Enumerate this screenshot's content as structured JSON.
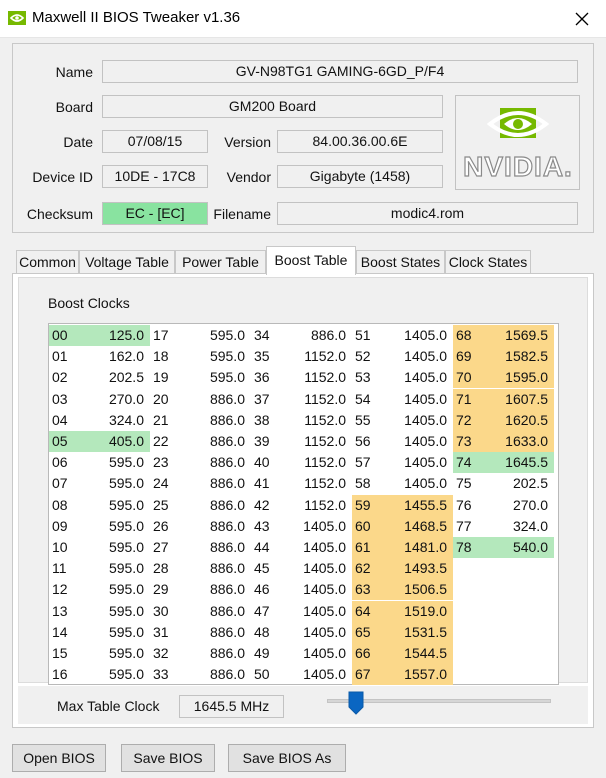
{
  "window": {
    "title": "Maxwell II BIOS Tweaker v1.36"
  },
  "info": {
    "name_label": "Name",
    "name_value": "GV-N98TG1 GAMING-6GD_P/F4",
    "board_label": "Board",
    "board_value": "GM200 Board",
    "date_label": "Date",
    "date_value": "07/08/15",
    "version_label": "Version",
    "version_value": "84.00.36.00.6E",
    "device_label": "Device ID",
    "device_value": "10DE - 17C8",
    "vendor_label": "Vendor",
    "vendor_value": "Gigabyte (1458)",
    "checksum_label": "Checksum",
    "checksum_value": "EC - [EC]",
    "filename_label": "Filename",
    "filename_value": "modic4.rom",
    "logo_text": "NVIDIA.",
    "checksum_color": "#89e3a0"
  },
  "tabs": [
    {
      "label": "Common"
    },
    {
      "label": "Voltage Table"
    },
    {
      "label": "Power Table"
    },
    {
      "label": "Boost Table"
    },
    {
      "label": "Boost States"
    },
    {
      "label": "Clock States"
    }
  ],
  "boost": {
    "group_title": "Boost Clocks",
    "highlight_green": "#b4e8bc",
    "highlight_yellow": "#fbd88a",
    "columns": [
      {
        "entries": [
          {
            "idx": "00",
            "val": "125.0",
            "hl": "green"
          },
          {
            "idx": "01",
            "val": "162.0",
            "hl": ""
          },
          {
            "idx": "02",
            "val": "202.5",
            "hl": ""
          },
          {
            "idx": "03",
            "val": "270.0",
            "hl": ""
          },
          {
            "idx": "04",
            "val": "324.0",
            "hl": ""
          },
          {
            "idx": "05",
            "val": "405.0",
            "hl": "green"
          },
          {
            "idx": "06",
            "val": "595.0",
            "hl": ""
          },
          {
            "idx": "07",
            "val": "595.0",
            "hl": ""
          },
          {
            "idx": "08",
            "val": "595.0",
            "hl": ""
          },
          {
            "idx": "09",
            "val": "595.0",
            "hl": ""
          },
          {
            "idx": "10",
            "val": "595.0",
            "hl": ""
          },
          {
            "idx": "11",
            "val": "595.0",
            "hl": ""
          },
          {
            "idx": "12",
            "val": "595.0",
            "hl": ""
          },
          {
            "idx": "13",
            "val": "595.0",
            "hl": ""
          },
          {
            "idx": "14",
            "val": "595.0",
            "hl": ""
          },
          {
            "idx": "15",
            "val": "595.0",
            "hl": ""
          },
          {
            "idx": "16",
            "val": "595.0",
            "hl": ""
          }
        ]
      },
      {
        "entries": [
          {
            "idx": "17",
            "val": "595.0",
            "hl": ""
          },
          {
            "idx": "18",
            "val": "595.0",
            "hl": ""
          },
          {
            "idx": "19",
            "val": "595.0",
            "hl": ""
          },
          {
            "idx": "20",
            "val": "886.0",
            "hl": ""
          },
          {
            "idx": "21",
            "val": "886.0",
            "hl": ""
          },
          {
            "idx": "22",
            "val": "886.0",
            "hl": ""
          },
          {
            "idx": "23",
            "val": "886.0",
            "hl": ""
          },
          {
            "idx": "24",
            "val": "886.0",
            "hl": ""
          },
          {
            "idx": "25",
            "val": "886.0",
            "hl": ""
          },
          {
            "idx": "26",
            "val": "886.0",
            "hl": ""
          },
          {
            "idx": "27",
            "val": "886.0",
            "hl": ""
          },
          {
            "idx": "28",
            "val": "886.0",
            "hl": ""
          },
          {
            "idx": "29",
            "val": "886.0",
            "hl": ""
          },
          {
            "idx": "30",
            "val": "886.0",
            "hl": ""
          },
          {
            "idx": "31",
            "val": "886.0",
            "hl": ""
          },
          {
            "idx": "32",
            "val": "886.0",
            "hl": ""
          },
          {
            "idx": "33",
            "val": "886.0",
            "hl": ""
          }
        ]
      },
      {
        "entries": [
          {
            "idx": "34",
            "val": "886.0",
            "hl": ""
          },
          {
            "idx": "35",
            "val": "1152.0",
            "hl": ""
          },
          {
            "idx": "36",
            "val": "1152.0",
            "hl": ""
          },
          {
            "idx": "37",
            "val": "1152.0",
            "hl": ""
          },
          {
            "idx": "38",
            "val": "1152.0",
            "hl": ""
          },
          {
            "idx": "39",
            "val": "1152.0",
            "hl": ""
          },
          {
            "idx": "40",
            "val": "1152.0",
            "hl": ""
          },
          {
            "idx": "41",
            "val": "1152.0",
            "hl": ""
          },
          {
            "idx": "42",
            "val": "1152.0",
            "hl": ""
          },
          {
            "idx": "43",
            "val": "1405.0",
            "hl": ""
          },
          {
            "idx": "44",
            "val": "1405.0",
            "hl": ""
          },
          {
            "idx": "45",
            "val": "1405.0",
            "hl": ""
          },
          {
            "idx": "46",
            "val": "1405.0",
            "hl": ""
          },
          {
            "idx": "47",
            "val": "1405.0",
            "hl": ""
          },
          {
            "idx": "48",
            "val": "1405.0",
            "hl": ""
          },
          {
            "idx": "49",
            "val": "1405.0",
            "hl": ""
          },
          {
            "idx": "50",
            "val": "1405.0",
            "hl": ""
          }
        ]
      },
      {
        "entries": [
          {
            "idx": "51",
            "val": "1405.0",
            "hl": ""
          },
          {
            "idx": "52",
            "val": "1405.0",
            "hl": ""
          },
          {
            "idx": "53",
            "val": "1405.0",
            "hl": ""
          },
          {
            "idx": "54",
            "val": "1405.0",
            "hl": ""
          },
          {
            "idx": "55",
            "val": "1405.0",
            "hl": ""
          },
          {
            "idx": "56",
            "val": "1405.0",
            "hl": ""
          },
          {
            "idx": "57",
            "val": "1405.0",
            "hl": ""
          },
          {
            "idx": "58",
            "val": "1405.0",
            "hl": ""
          },
          {
            "idx": "59",
            "val": "1455.5",
            "hl": "yellow"
          },
          {
            "idx": "60",
            "val": "1468.5",
            "hl": "yellow"
          },
          {
            "idx": "61",
            "val": "1481.0",
            "hl": "yellow"
          },
          {
            "idx": "62",
            "val": "1493.5",
            "hl": "yellow"
          },
          {
            "idx": "63",
            "val": "1506.5",
            "hl": "yellow"
          },
          {
            "idx": "64",
            "val": "1519.0",
            "hl": "yellow"
          },
          {
            "idx": "65",
            "val": "1531.5",
            "hl": "yellow"
          },
          {
            "idx": "66",
            "val": "1544.5",
            "hl": "yellow"
          },
          {
            "idx": "67",
            "val": "1557.0",
            "hl": "yellow"
          }
        ]
      },
      {
        "entries": [
          {
            "idx": "68",
            "val": "1569.5",
            "hl": "yellow"
          },
          {
            "idx": "69",
            "val": "1582.5",
            "hl": "yellow"
          },
          {
            "idx": "70",
            "val": "1595.0",
            "hl": "yellow"
          },
          {
            "idx": "71",
            "val": "1607.5",
            "hl": "yellow"
          },
          {
            "idx": "72",
            "val": "1620.5",
            "hl": "yellow"
          },
          {
            "idx": "73",
            "val": "1633.0",
            "hl": "yellow"
          },
          {
            "idx": "74",
            "val": "1645.5",
            "hl": "green"
          },
          {
            "idx": "75",
            "val": "202.5",
            "hl": ""
          },
          {
            "idx": "76",
            "val": "270.0",
            "hl": ""
          },
          {
            "idx": "77",
            "val": "324.0",
            "hl": ""
          },
          {
            "idx": "78",
            "val": "540.0",
            "hl": "green"
          }
        ]
      }
    ],
    "max_label": "Max Table Clock",
    "max_value": "1645.5 MHz",
    "slider_level": 0.1
  },
  "buttons": {
    "open": "Open BIOS",
    "save": "Save BIOS",
    "save_as": "Save BIOS As"
  }
}
